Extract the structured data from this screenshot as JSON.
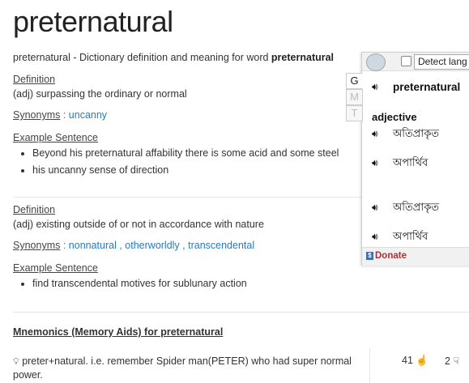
{
  "page": {
    "title": "preternatural",
    "intro_prefix": "preternatural - Dictionary definition and meaning for word ",
    "intro_word": "preternatural"
  },
  "senses": [
    {
      "definition_label": "Definition",
      "definition": "(adj) surpassing the ordinary or normal",
      "synonyms_label": "Synonyms",
      "synonyms": [
        "uncanny"
      ],
      "example_label": "Example Sentence",
      "examples": [
        "Beyond his preternatural affability there is some acid and some steel",
        "his uncanny sense of direction"
      ]
    },
    {
      "definition_label": "Definition",
      "definition": "(adj) existing outside of or not in accordance with nature",
      "synonyms_label": "Synonyms",
      "synonyms": [
        "nonnatural",
        "otherworldly",
        "transcendental"
      ],
      "example_label": "Example Sentence",
      "examples": [
        "find transcendental motives for sublunary action"
      ]
    }
  ],
  "mnemonics": {
    "title": "Mnemonics (Memory Aids) for preternatural",
    "text": "preter+natural. i.e. remember Spider man(PETER) who had super normal power.",
    "upvotes": "41",
    "downvotes": "2"
  },
  "popup": {
    "language_select": "Detect lang",
    "tabs": [
      "G",
      "M",
      "T"
    ],
    "word": "preternatural",
    "pos": "adjective",
    "translations": [
      "অতিপ্রাকৃত",
      "অপার্থিব",
      "অতিপ্রাকৃত",
      "অপার্থিব"
    ],
    "donate": "Donate"
  }
}
